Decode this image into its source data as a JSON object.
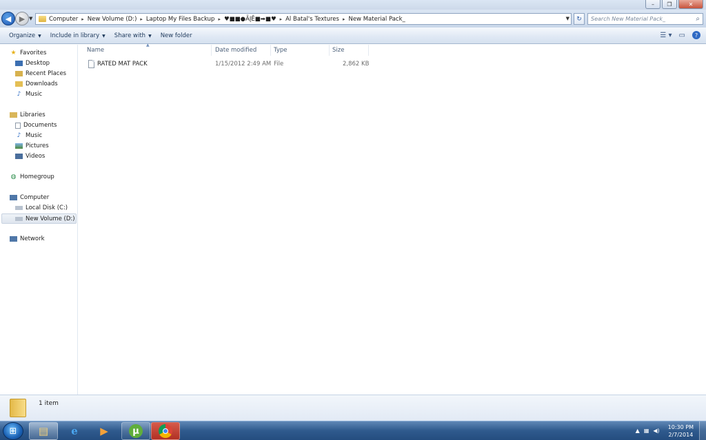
{
  "window": {
    "minimize": "–",
    "maximize": "❐",
    "close": "✕"
  },
  "address": {
    "crumbs": [
      "Computer",
      "New Volume (D:)",
      "Laptop My Files Backup",
      "♥■■●ÃĮÊ■➡■♥",
      "Al Batal's Textures",
      "New Material Pack_"
    ],
    "search_placeholder": "Search New Material Pack_"
  },
  "toolbar": {
    "organize": "Organize",
    "include": "Include in library",
    "share": "Share with",
    "new_folder": "New folder"
  },
  "nav": {
    "favorites": "Favorites",
    "desktop": "Desktop",
    "recent": "Recent Places",
    "downloads": "Downloads",
    "music_fav": "Music",
    "libraries": "Libraries",
    "documents": "Documents",
    "music": "Music",
    "pictures": "Pictures",
    "videos": "Videos",
    "homegroup": "Homegroup",
    "computer": "Computer",
    "local_disk": "Local Disk (C:)",
    "new_volume": "New Volume (D:)",
    "network": "Network"
  },
  "columns": {
    "name": "Name",
    "date": "Date modified",
    "type": "Type",
    "size": "Size"
  },
  "files": [
    {
      "name": "RATED MAT PACK",
      "date": "1/15/2012 2:49 AM",
      "type": "File",
      "size": "2,862 KB"
    }
  ],
  "details": {
    "count": "1 item"
  },
  "clock": {
    "time": "10:30 PM",
    "date": "2/7/2014"
  },
  "colors": {
    "taskbar": "#2f5a8d",
    "selection": "#dfe6ef"
  }
}
